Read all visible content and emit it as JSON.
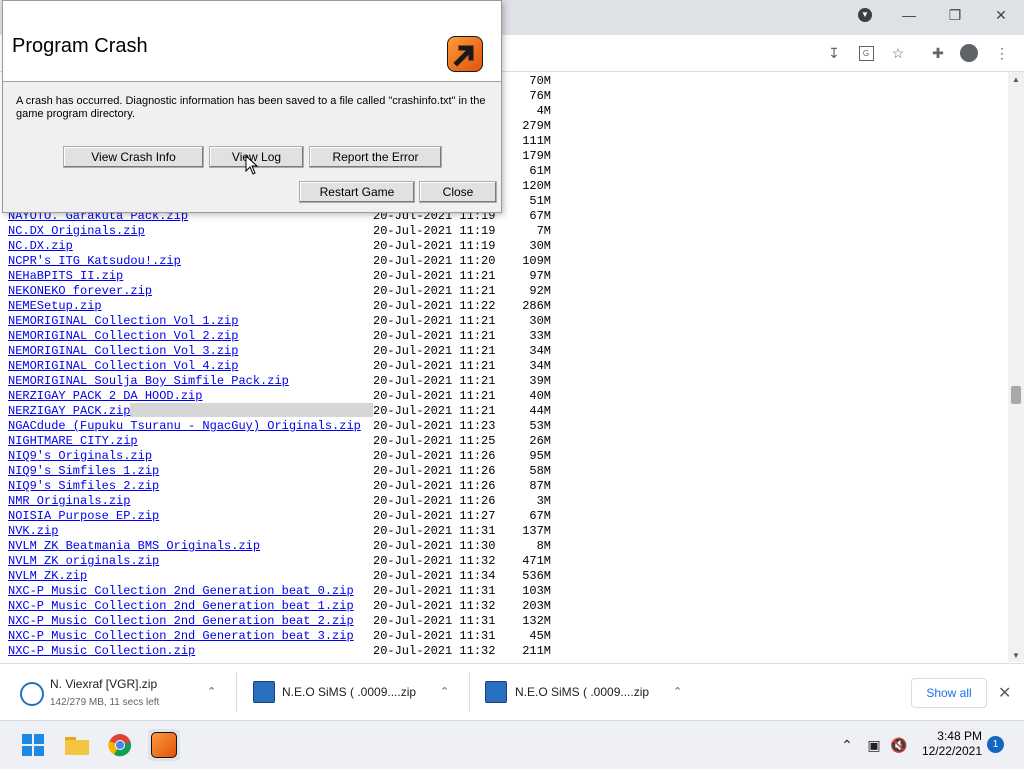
{
  "dialog": {
    "title": "Program Crash",
    "message": "A crash has occurred.  Diagnostic information has been saved to a file called \"crashinfo.txt\" in the game program directory.",
    "buttons": {
      "view_crash_info": "View Crash Info",
      "view_log": "View Log",
      "report_error": "Report the Error",
      "restart_game": "Restart Game",
      "close": "Close"
    }
  },
  "hidden_sizes": [
    "70M",
    "76M",
    "4M",
    "279M",
    "111M",
    "179M",
    "61M",
    "120M",
    "51M"
  ],
  "files": [
    {
      "name": "NAYOTO. Garakuta Pack.zip",
      "date": "20-Jul-2021 11:19",
      "size": "67M"
    },
    {
      "name": "NC.DX Originals.zip",
      "date": "20-Jul-2021 11:19",
      "size": "7M"
    },
    {
      "name": "NC.DX.zip",
      "date": "20-Jul-2021 11:19",
      "size": "30M"
    },
    {
      "name": "NCPR's ITG Katsudou!.zip",
      "date": "20-Jul-2021 11:20",
      "size": "109M"
    },
    {
      "name": "NEHaBPITS II.zip",
      "date": "20-Jul-2021 11:21",
      "size": "97M"
    },
    {
      "name": "NEKONEKO forever.zip",
      "date": "20-Jul-2021 11:21",
      "size": "92M"
    },
    {
      "name": "NEMESetup.zip",
      "date": "20-Jul-2021 11:22",
      "size": "286M"
    },
    {
      "name": "NEMORIGINAL Collection Vol 1.zip",
      "date": "20-Jul-2021 11:21",
      "size": "30M"
    },
    {
      "name": "NEMORIGINAL Collection Vol 2.zip",
      "date": "20-Jul-2021 11:21",
      "size": "33M"
    },
    {
      "name": "NEMORIGINAL Collection Vol 3.zip",
      "date": "20-Jul-2021 11:21",
      "size": "34M"
    },
    {
      "name": "NEMORIGINAL Collection Vol 4.zip",
      "date": "20-Jul-2021 11:21",
      "size": "34M"
    },
    {
      "name": "NEMORIGINAL Soulja Boy Simfile Pack.zip",
      "date": "20-Jul-2021 11:21",
      "size": "39M"
    },
    {
      "name": "NERZIGAY PACK 2 DA HOOD.zip",
      "date": "20-Jul-2021 11:21",
      "size": "40M"
    },
    {
      "name": "NERZIGAY PACK.zip",
      "date": "20-Jul-2021 11:21",
      "size": "44M"
    },
    {
      "name": "NGACdude (Fupuku Tsuranu - NgacGuy) Originals.zip",
      "date": "20-Jul-2021 11:23",
      "size": "53M"
    },
    {
      "name": "NIGHTMARE CITY.zip",
      "date": "20-Jul-2021 11:25",
      "size": "26M"
    },
    {
      "name": "NIQ9's Originals.zip",
      "date": "20-Jul-2021 11:26",
      "size": "95M"
    },
    {
      "name": "NIQ9's Simfiles 1.zip",
      "date": "20-Jul-2021 11:26",
      "size": "58M"
    },
    {
      "name": "NIQ9's Simfiles 2.zip",
      "date": "20-Jul-2021 11:26",
      "size": "87M"
    },
    {
      "name": "NMR Originals.zip",
      "date": "20-Jul-2021 11:26",
      "size": "3M"
    },
    {
      "name": "NOISIA Purpose EP.zip",
      "date": "20-Jul-2021 11:27",
      "size": "67M"
    },
    {
      "name": "NVK.zip",
      "date": "20-Jul-2021 11:31",
      "size": "137M"
    },
    {
      "name": "NVLM ZK Beatmania BMS Originals.zip",
      "date": "20-Jul-2021 11:30",
      "size": "8M"
    },
    {
      "name": "NVLM ZK originals.zip",
      "date": "20-Jul-2021 11:32",
      "size": "471M"
    },
    {
      "name": "NVLM ZK.zip",
      "date": "20-Jul-2021 11:34",
      "size": "536M"
    },
    {
      "name": "NXC-P Music Collection 2nd Generation beat 0.zip",
      "date": "20-Jul-2021 11:31",
      "size": "103M"
    },
    {
      "name": "NXC-P Music Collection 2nd Generation beat 1.zip",
      "date": "20-Jul-2021 11:32",
      "size": "203M"
    },
    {
      "name": "NXC-P Music Collection 2nd Generation beat 2.zip",
      "date": "20-Jul-2021 11:31",
      "size": "132M"
    },
    {
      "name": "NXC-P Music Collection 2nd Generation beat 3.zip",
      "date": "20-Jul-2021 11:31",
      "size": "45M"
    },
    {
      "name": "NXC-P Music Collection.zip",
      "date": "20-Jul-2021 11:32",
      "size": "211M"
    }
  ],
  "downloads": {
    "items": [
      {
        "name": "N. Viexraf [VGR].zip",
        "status": "142/279 MB, 11 secs left"
      },
      {
        "name": "N.E.O SiMS ( .0009....zip",
        "status": ""
      },
      {
        "name": "N.E.O SiMS ( .0009....zip",
        "status": ""
      }
    ],
    "show_all": "Show all"
  },
  "taskbar": {
    "time": "3:48 PM",
    "date": "12/22/2021",
    "notification_count": "1"
  }
}
